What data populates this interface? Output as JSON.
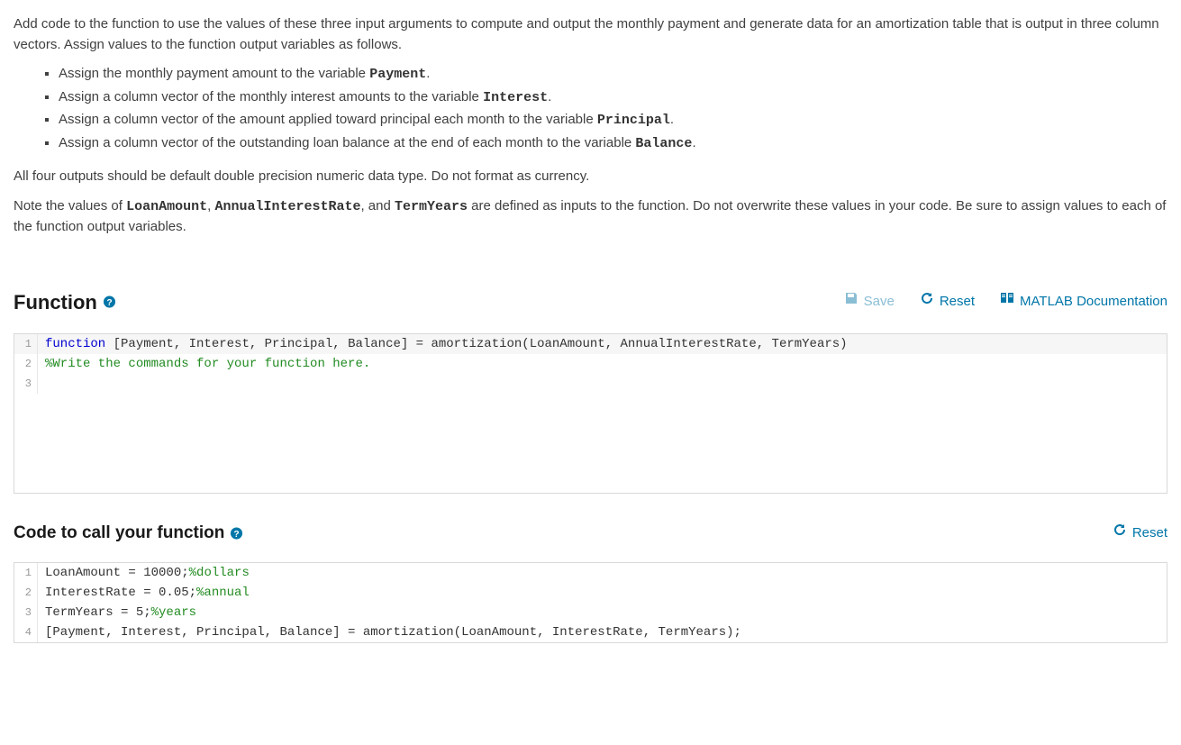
{
  "instructions": {
    "intro": "Add code to the function to use the values of these three input arguments to compute and output the monthly payment and generate data for an amortization table that is output in three column vectors. Assign values to the function output variables as follows.",
    "bullets": [
      {
        "pre": "Assign the monthly payment amount to the variable ",
        "var": "Payment",
        "post": "."
      },
      {
        "pre": "Assign a column vector of the monthly interest amounts to the variable ",
        "var": "Interest",
        "post": "."
      },
      {
        "pre": "Assign a column vector of the amount applied toward principal each month to the variable ",
        "var": "Principal",
        "post": "."
      },
      {
        "pre": "Assign a column vector of the outstanding loan balance at the end of each month to the variable ",
        "var": "Balance",
        "post": "."
      }
    ],
    "precision": "All four outputs should be default double precision numeric data type. Do not format as currency.",
    "note_pre": "Note the values of ",
    "note_var1": "LoanAmount",
    "note_sep1": ", ",
    "note_var2": "AnnualInterestRate",
    "note_sep2": ", and ",
    "note_var3": "TermYears",
    "note_post": " are defined as inputs to the function.  Do not overwrite these values in your code.  Be sure to assign values to each of the function output variables."
  },
  "function_section": {
    "title": "Function",
    "save_label": "Save",
    "reset_label": "Reset",
    "doc_label": "MATLAB Documentation",
    "lines": {
      "l1_kw": "function",
      "l1_rest": " [Payment, Interest, Principal, Balance] = amortization(LoanAmount, AnnualInterestRate, TermYears)",
      "l2": "%Write the commands for your function here.",
      "n1": "1",
      "n2": "2",
      "n3": "3"
    }
  },
  "call_section": {
    "title": "Code to call your function",
    "reset_label": "Reset",
    "lines": {
      "l1a": "LoanAmount = 10000;",
      "l1b": "%dollars",
      "l2a": "InterestRate = 0.05;",
      "l2b": "%annual",
      "l3a": "TermYears = 5;",
      "l3b": "%years",
      "l4": "[Payment, Interest, Principal, Balance] = amortization(LoanAmount, InterestRate, TermYears);",
      "n1": "1",
      "n2": "2",
      "n3": "3",
      "n4": "4"
    }
  }
}
